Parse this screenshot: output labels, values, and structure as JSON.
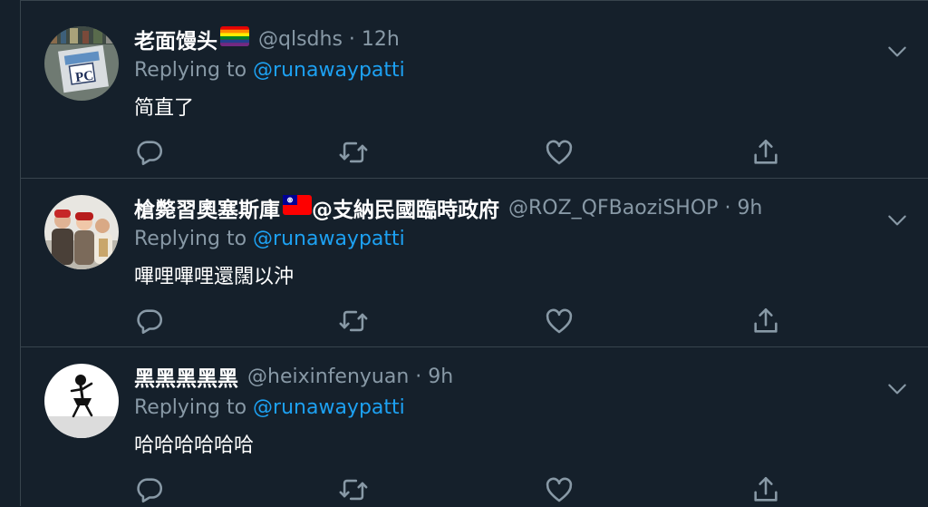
{
  "tweets": [
    {
      "display_name": "老面馒头",
      "handle": "@qlsdhs",
      "separator": "·",
      "time": "12h",
      "replying_label": "Replying to",
      "replying_to": "@runawaypatti",
      "text": "简直了",
      "name_icon": "rainbow-flag-emoji",
      "avatar_text": "PC"
    },
    {
      "display_name": "槍斃習奧塞斯庫",
      "display_name_suffix": "@支納民國臨時政府",
      "handle": "@ROZ_QFBaoziSHOP",
      "separator": "·",
      "time": "9h",
      "replying_label": "Replying to",
      "replying_to": "@runawaypatti",
      "text": "嗶哩嗶哩還闊以沖",
      "name_icon": "taiwan-flag-emoji"
    },
    {
      "display_name": "黑黑黑黑黑",
      "handle": "@heixinfenyuan",
      "separator": "·",
      "time": "9h",
      "replying_label": "Replying to",
      "replying_to": "@runawaypatti",
      "text": "哈哈哈哈哈哈"
    }
  ],
  "actions": [
    "reply-icon",
    "retweet-icon",
    "like-icon",
    "share-icon"
  ],
  "colors": {
    "background": "#15202b",
    "border": "#38444d",
    "secondary_text": "#8899a6",
    "link": "#1da1f2",
    "primary_text": "#ffffff"
  }
}
